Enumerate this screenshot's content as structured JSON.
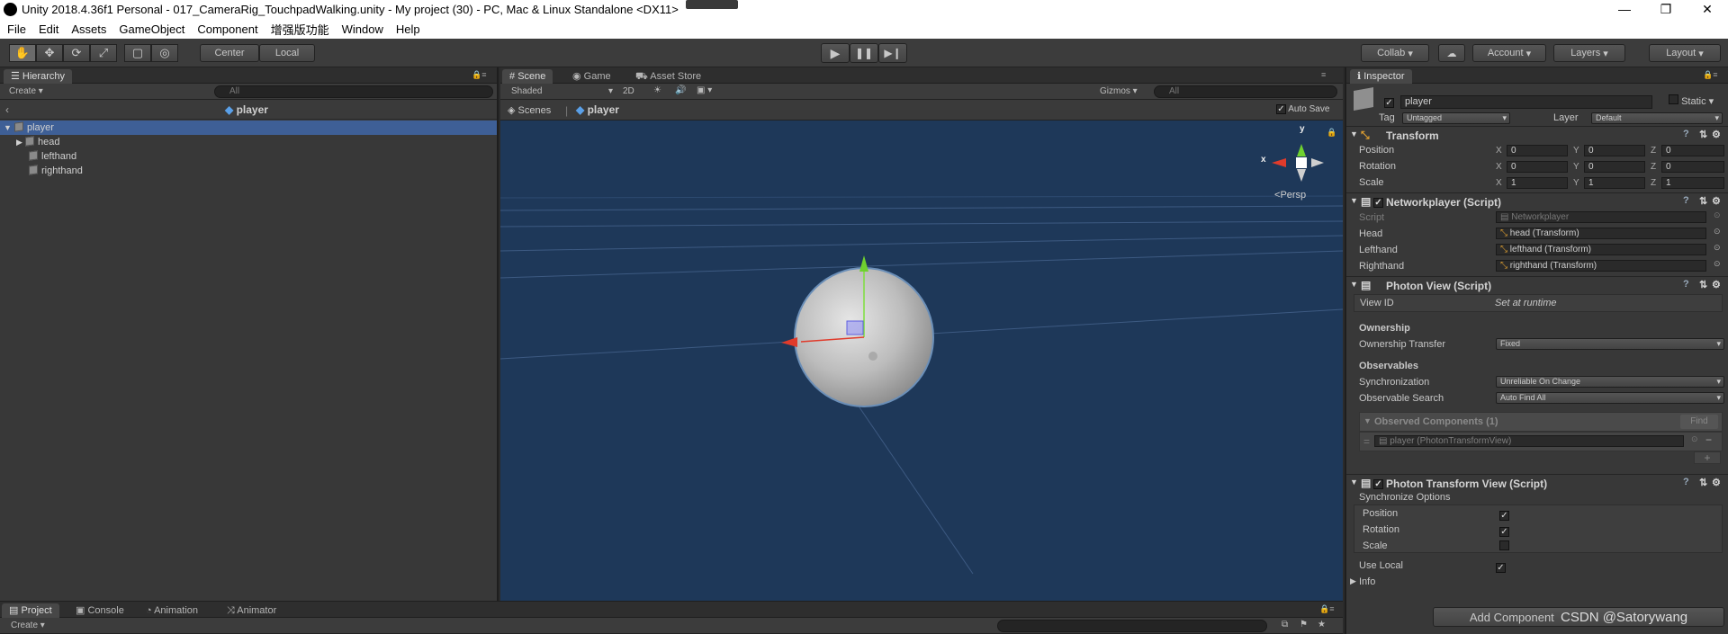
{
  "window": {
    "title": "Unity 2018.4.36f1 Personal - 017_CameraRig_TouchpadWalking.unity - My project (30) - PC, Mac & Linux Standalone <DX11>",
    "minimize": "—",
    "maximize": "❐",
    "close": "✕"
  },
  "menu": [
    "File",
    "Edit",
    "Assets",
    "GameObject",
    "Component",
    "增强版功能",
    "Window",
    "Help"
  ],
  "toolbar": {
    "center": "Center",
    "local": "Local",
    "collab": "Collab",
    "account": "Account",
    "layers": "Layers",
    "layout": "Layout"
  },
  "hierarchy": {
    "tab": "Hierarchy",
    "create": "Create",
    "search_placeholder": "All",
    "breadcrumb": "player",
    "items": [
      "player",
      "head",
      "lefthand",
      "righthand"
    ]
  },
  "scene": {
    "tabs": [
      "Scene",
      "Game",
      "Asset Store"
    ],
    "shading": "Shaded",
    "mode2d": "2D",
    "gizmos": "Gizmos",
    "search_placeholder": "All",
    "breadcrumb_root": "Scenes",
    "breadcrumb_item": "player",
    "auto_save": "Auto Save",
    "persp": "Persp",
    "axis_y": "y",
    "axis_x": "x"
  },
  "inspector": {
    "tab": "Inspector",
    "object_name": "player",
    "static": "Static",
    "tag_label": "Tag",
    "tag_value": "Untagged",
    "layer_label": "Layer",
    "layer_value": "Default",
    "transform": {
      "title": "Transform",
      "position_label": "Position",
      "rotation_label": "Rotation",
      "scale_label": "Scale",
      "x": "X",
      "y": "Y",
      "z": "Z",
      "position": [
        "0",
        "0",
        "0"
      ],
      "rotation": [
        "0",
        "0",
        "0"
      ],
      "scale": [
        "1",
        "1",
        "1"
      ]
    },
    "networkplayer": {
      "title": "Networkplayer (Script)",
      "script_label": "Script",
      "script_value": "Networkplayer",
      "head_label": "Head",
      "head_value": "head (Transform)",
      "lefthand_label": "Lefthand",
      "lefthand_value": "lefthand (Transform)",
      "righthand_label": "Righthand",
      "righthand_value": "righthand (Transform)"
    },
    "photon_view": {
      "title": "Photon View (Script)",
      "view_id_label": "View ID",
      "view_id_value": "Set at runtime",
      "ownership_header": "Ownership",
      "ownership_transfer_label": "Ownership Transfer",
      "ownership_transfer_value": "Fixed",
      "observables_header": "Observables",
      "synchronization_label": "Synchronization",
      "synchronization_value": "Unreliable On Change",
      "observable_search_label": "Observable Search",
      "observable_search_value": "Auto Find All",
      "observed_components": "Observed Components (1)",
      "find": "Find",
      "observed_item": "player (PhotonTransformView)"
    },
    "photon_transform_view": {
      "title": "Photon Transform View (Script)",
      "sync_options": "Synchronize Options",
      "position_label": "Position",
      "rotation_label": "Rotation",
      "scale_label": "Scale",
      "use_local_label": "Use Local",
      "info_label": "Info"
    },
    "add_component": "Add Component",
    "watermark": "CSDN @Satorywang"
  },
  "bottom": {
    "tabs": [
      "Project",
      "Console",
      "Animation",
      "Animator"
    ],
    "create": "Create"
  }
}
